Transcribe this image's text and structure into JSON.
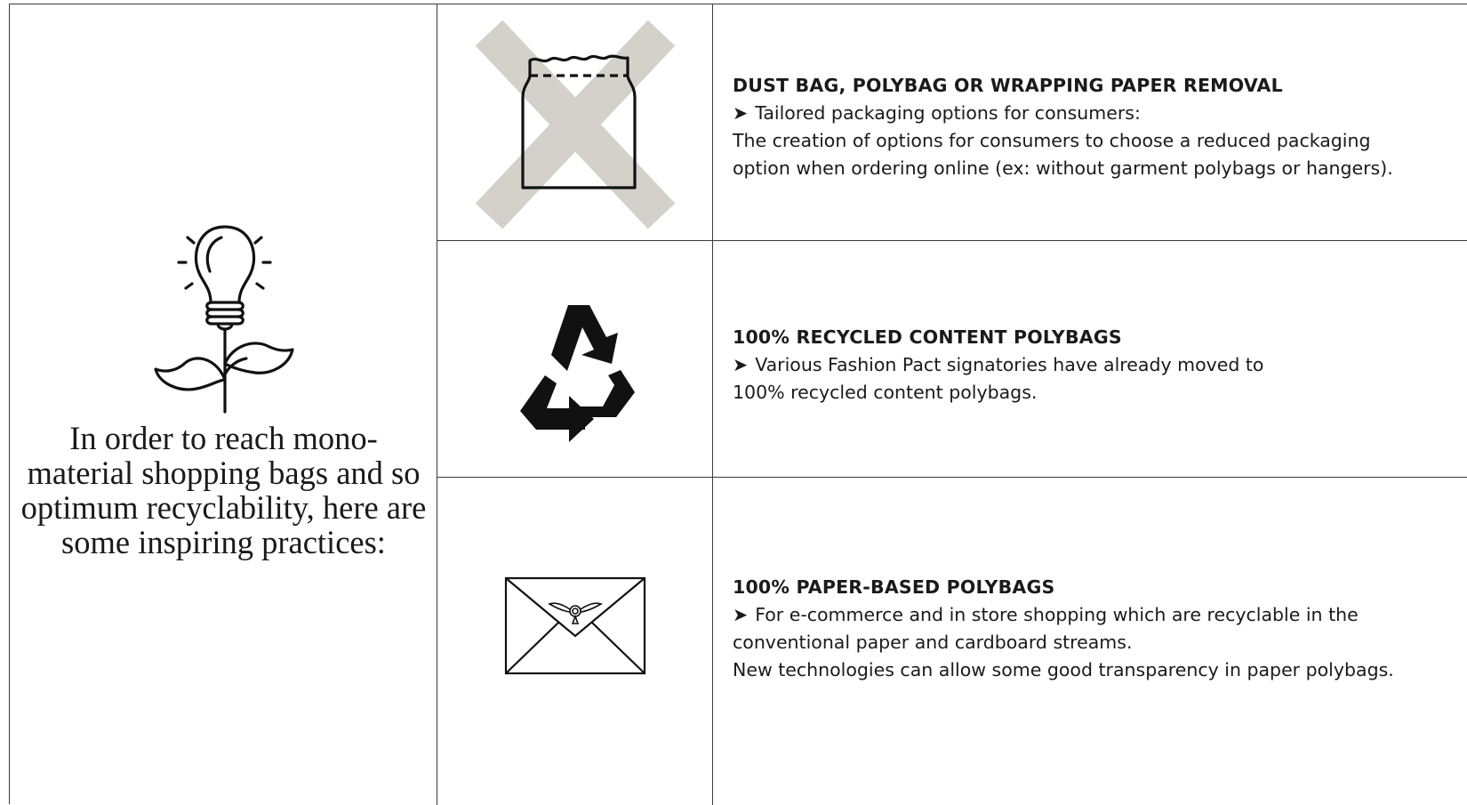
{
  "intro": {
    "text": "In order to reach mono-material shopping bags and so optimum recyclability, here are some inspiring practices:",
    "lines": [
      "In order to reach mono-",
      "material shopping bags and so",
      "optimum recyclability, here are",
      "some inspiring practices:"
    ],
    "icon": "lightbulb-plant-icon"
  },
  "practices": [
    {
      "icon": "crossed-out-polybag-icon",
      "heading": "DUST BAG, POLYBAG OR WRAPPING PAPER REMOVAL",
      "bullet_marker": "➤",
      "bullet": "Tailored packaging options for consumers:",
      "detail_lines": [
        "The creation of options for consumers to choose a reduced packaging",
        "option when ordering online (ex: without garment polybags or hangers)."
      ]
    },
    {
      "icon": "recycle-symbol-icon",
      "heading": "100% RECYCLED CONTENT POLYBAGS",
      "bullet_marker": "➤",
      "bullet": "Various Fashion Pact signatories have already moved to",
      "detail_lines": [
        "100% recycled content polybags."
      ]
    },
    {
      "icon": "paper-envelope-icon",
      "heading": "100% PAPER-BASED POLYBAGS",
      "bullet_marker": "➤",
      "bullet": "For e-commerce and in store shopping which are recyclable in the",
      "detail_lines": [
        "conventional paper and cardboard streams.",
        "New technologies can allow some good transparency in paper polybags."
      ]
    }
  ],
  "colors": {
    "cross": "#d3d1ca",
    "border": "#3a3a3a",
    "ink": "#111111"
  }
}
